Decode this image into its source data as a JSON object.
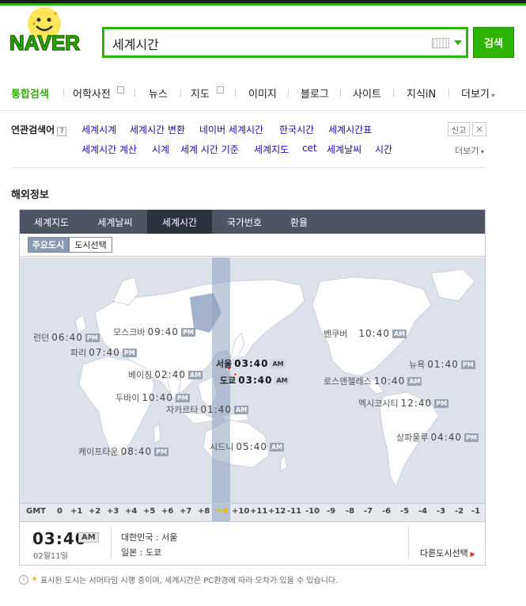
{
  "logo": {
    "text": "NAVER"
  },
  "search": {
    "value": "세계시간",
    "button": "검색"
  },
  "nav": {
    "items": [
      "통합검색",
      "어학사전",
      "뉴스",
      "지도",
      "이미지",
      "블로그",
      "사이트",
      "지식iN",
      "더보기"
    ],
    "active": "통합검색"
  },
  "related": {
    "heading": "연관검색어",
    "help": "?",
    "row1": [
      "세계시계",
      "세계시간 변환",
      "네이버 세계시간",
      "한국시간",
      "세계시간표"
    ],
    "row2": [
      "세계시간 계산",
      "시계",
      "세계 시간 기준",
      "세계지도",
      "cet",
      "세계날씨",
      "시간"
    ],
    "report": "신고",
    "more": "더보기"
  },
  "section_title": "해외정보",
  "widget": {
    "tabs": [
      "세계지도",
      "세계날씨",
      "세계시간",
      "국가번호",
      "환율"
    ],
    "active_tab": "세계시간",
    "subtabs": [
      "주요도시",
      "도시선택"
    ],
    "active_subtab": "주요도시",
    "cities": [
      {
        "name": "모스크바",
        "time": "09:40",
        "ampm": "PM"
      },
      {
        "name": "런던",
        "time": "06:40",
        "ampm": "PM"
      },
      {
        "name": "파리",
        "time": "07:40",
        "ampm": "PM"
      },
      {
        "name": "베이징",
        "time": "02:40",
        "ampm": "AM"
      },
      {
        "name": "두바이",
        "time": "10:40",
        "ampm": "PM"
      },
      {
        "name": "자카르타",
        "time": "01:40",
        "ampm": "AM"
      },
      {
        "name": "케이프타운",
        "time": "08:40",
        "ampm": "PM"
      },
      {
        "name": "서울",
        "time": "03:40",
        "ampm": "AM"
      },
      {
        "name": "도쿄",
        "time": "03:40",
        "ampm": "AM"
      },
      {
        "name": "시드니",
        "time": "05:40",
        "ampm": "AM"
      },
      {
        "name": "벤쿠버",
        "time": "10:40",
        "ampm": "AM"
      },
      {
        "name": "뉴욕",
        "time": "01:40",
        "ampm": "PM"
      },
      {
        "name": "로스엔젤레스",
        "time": "10:40",
        "ampm": "AM"
      },
      {
        "name": "멕시코시티",
        "time": "12:40",
        "ampm": "PM"
      },
      {
        "name": "상파울루",
        "time": "04:40",
        "ampm": "PM"
      }
    ],
    "gmt_label": "GMT",
    "gmt_offsets": [
      "0",
      "+1",
      "+2",
      "+3",
      "+4",
      "+5",
      "+6",
      "+7",
      "+8",
      "+9",
      "+10",
      "+11",
      "+12",
      "-11",
      "-10",
      "-9",
      "-8",
      "-7",
      "-6",
      "-5",
      "-4",
      "-3",
      "-2",
      "-1"
    ],
    "current_offset": "+9",
    "current": {
      "time": "03:40",
      "ampm": "AM",
      "date": "02월11일",
      "country_line": "대한민국 : 서울",
      "city_line": "일본 : 도쿄",
      "other_city": "다른도시선택"
    }
  },
  "note": "표시된 도시는 서머타임 시행 중이며, 세계시간은 PC환경에 따라 오차가 있을 수 있습니다.",
  "colors": {
    "brand": "#2db400",
    "tab_bar": "#4d5462",
    "map_bg": "#dde1ea",
    "land": "#ffffff"
  }
}
